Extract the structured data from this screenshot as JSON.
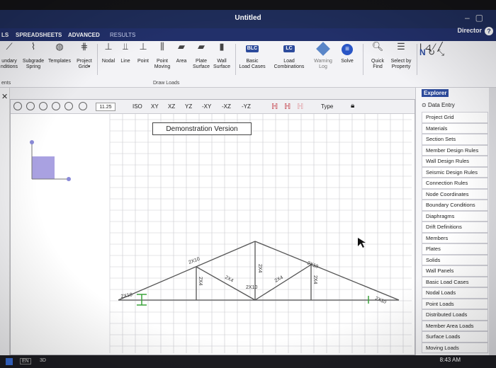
{
  "window": {
    "title": "Untitled",
    "user_mode": "Director"
  },
  "menu_tabs": [
    "LS",
    "SPREADSHEETS",
    "ADVANCED",
    "RESULTS"
  ],
  "ribbon": {
    "buttons": [
      {
        "id": "boundary",
        "label": "undary\nnditions",
        "icon": "boundary-icon"
      },
      {
        "id": "subgrade",
        "label": "Subgrade\nSpring",
        "icon": "subgrade-icon"
      },
      {
        "id": "templates",
        "label": "Templates",
        "icon": "templates-icon"
      },
      {
        "id": "project-grid",
        "label": "Project\nGrid▾",
        "icon": "grid-icon"
      },
      {
        "id": "nodal",
        "label": "Nodal",
        "icon": "nodal-icon"
      },
      {
        "id": "line",
        "label": "Line",
        "icon": "line-icon"
      },
      {
        "id": "point",
        "label": "Point",
        "icon": "point-icon"
      },
      {
        "id": "point-moving",
        "label": "Point\nMoving",
        "icon": "point-moving-icon"
      },
      {
        "id": "area",
        "label": "Area",
        "icon": "area-icon"
      },
      {
        "id": "plate-surface",
        "label": "Plate\nSurface",
        "icon": "plate-icon"
      },
      {
        "id": "wall-surface",
        "label": "Wall\nSurface",
        "icon": "wall-icon"
      },
      {
        "id": "basic-load-cases",
        "label": "Basic\nLoad Cases",
        "icon": "blc-icon",
        "badge": "BLC"
      },
      {
        "id": "load-combinations",
        "label": "Load\nCombinations",
        "icon": "lc-icon",
        "badge": "LC"
      },
      {
        "id": "warning-log",
        "label": "Warning\nLog",
        "icon": "warning-icon"
      },
      {
        "id": "solve",
        "label": "Solve",
        "icon": "solve-icon"
      },
      {
        "id": "quick-find",
        "label": "Quick\nFind",
        "icon": "magnifier-icon"
      },
      {
        "id": "select-property",
        "label": "Select by\nProperty",
        "icon": "list-icon"
      }
    ],
    "group_labels": {
      "left": "ents",
      "draw_loads": "Draw Loads"
    }
  },
  "view_toolbar": {
    "zoom": "11.25",
    "views": [
      "ISO",
      "XY",
      "XZ",
      "YZ",
      "-XY",
      "-XZ",
      "-YZ"
    ],
    "type_label": "Type"
  },
  "banner": "Demonstration Version",
  "truss": {
    "member_labels": [
      "2X10",
      "2X10",
      "2X10",
      "2X10",
      "2X10",
      "2X4",
      "2X4",
      "2X4",
      "2X4",
      "2X4"
    ]
  },
  "explorer": {
    "tab": "Explorer",
    "section": "Data Entry",
    "items": [
      "Project Grid",
      "Materials",
      "Section Sets",
      "Member Design Rules",
      "Wall Design Rules",
      "Seismic Design Rules",
      "Connection Rules",
      "Node Coordinates",
      "Boundary Conditions",
      "Diaphragms",
      "Drift Definitions",
      "Members",
      "Plates",
      "Solids",
      "Wall Panels",
      "Basic Load Cases",
      "Nodal Loads",
      "Point Loads",
      "Distributed Loads",
      "Member Area Loads",
      "Surface Loads",
      "Moving Loads"
    ]
  },
  "taskbar": {
    "lang": "EN",
    "mode": "3D",
    "time": "8:43 AM"
  },
  "colors": {
    "titlebar": "#1f2d5a",
    "accent": "#2d4b9c",
    "member": "#555555",
    "node": "#8a8ad8"
  }
}
